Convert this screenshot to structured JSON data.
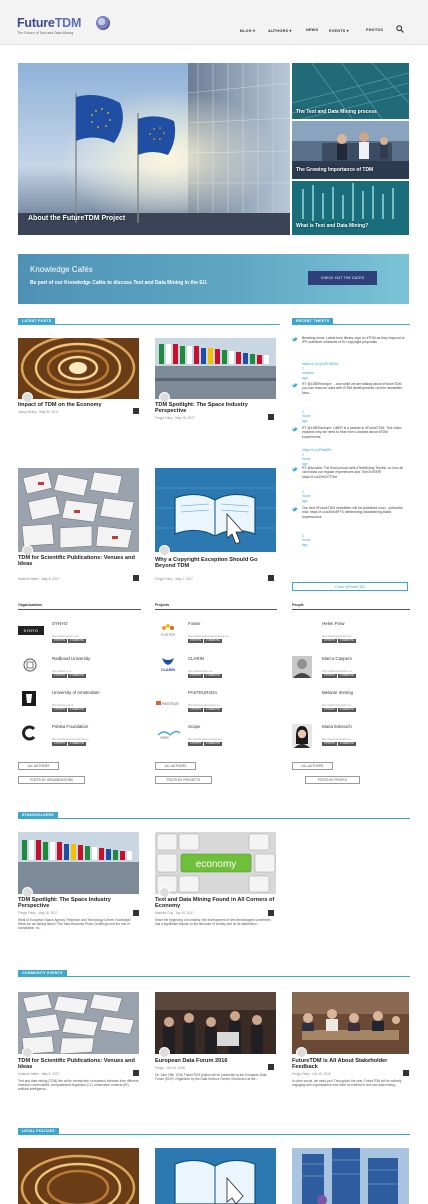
{
  "header": {
    "logo_future": "Future",
    "logo_tdm": "TDM",
    "tagline": "The Future of Text and Data Mining",
    "nav": [
      {
        "label": "BLOG ▾"
      },
      {
        "label": "AUTHORS ▾"
      },
      {
        "label": "NEWS"
      },
      {
        "label": "EVENTS ▾"
      },
      {
        "label": "PHOTOS"
      }
    ]
  },
  "hero": {
    "main_caption": "About the FutureTDM Project",
    "side": [
      {
        "caption": "The Text and Data Mining process"
      },
      {
        "caption": "The Growing Importance of TDM"
      },
      {
        "caption": "What is Text and Data Mining?"
      }
    ]
  },
  "knowledge_cafe": {
    "title": "Knowledge Cafés",
    "subtitle": "Be part of our Knowledge Cafés to discuss Text and Data Mining in the EU.",
    "button": "CHECK OUT THE DATES"
  },
  "latest_posts": {
    "tab": "LATEST POSTS",
    "posts": [
      {
        "title": "Impact of TDM on the Economy",
        "meta": "Jenny Molloy · May 30, 2017"
      },
      {
        "title": "TDM Spotlight: The Space Industry Perspective",
        "meta": "Freyja Foley · May 18, 2017"
      },
      {
        "title": "TDM for Scientific Publications: Venues and Ideas",
        "meta": "Kristina Hettne · May 8, 2017"
      },
      {
        "title": "Why a Copyright Exception Should Go Beyond TDM",
        "meta": "Freyja Foley · May 2, 2017"
      }
    ]
  },
  "recent_tweets": {
    "tab": "RECENT TWEETS",
    "tweets": [
      {
        "text": "Breaking news: Latest from library orgs on #TDM as they respond to IPR publisher criticisms of EU copyright proposals",
        "link": "https://t.co/Q0yRHx82W",
        "time": "7 minutes ago"
      },
      {
        "text": "RT @LIBEReurope: ...and while we are talking about #FutureTDM you can read our data with #TDM developments via this newsletter. New...",
        "link": "",
        "time": "2 hours ago"
      },
      {
        "text": "RT @LIBEReurope: LIBER is a partner in #FutureTDM. This video explains why we need to hear from Libraries about #TDM experiences.",
        "link": "https://t.co/ZfAwjRb",
        "time": "2 hours ago"
      },
      {
        "text": "RT @suzaba: The final journal calls #TextMining TechNL on how all can follow our regular experiences and TheOf #SERI https://t.co/ZHeZi7FJhe",
        "link": "",
        "time": "2 hours ago"
      },
      {
        "text": "Our next #FutureTDM newsletter will be published soon - subscribe now: https://t.co/z2b6v5FTK #textmining #datamining #data #opensource",
        "link": "",
        "time": "2 hours ago"
      }
    ],
    "follow_button": "Follow @FutureTDM"
  },
  "directory": {
    "organisations": {
      "heading": "Organisations",
      "items": [
        {
          "name": "SYNYO",
          "url": "http://www.synyo.com"
        },
        {
          "name": "Radboud University",
          "url": "http://www.ru.nl"
        },
        {
          "name": "University of Amsterdam",
          "url": "http://www.uva.nl"
        },
        {
          "name": "Polska Foundation",
          "url": "http://www.centrumcyfrowe.pl"
        }
      ],
      "all_button": "ALL AUTHORS",
      "posts_button": "POSTS BY ORGANISATIONS"
    },
    "projects": {
      "heading": "Projects",
      "items": [
        {
          "name": "Foster",
          "url": "http://www.fosteropenscience.eu"
        },
        {
          "name": "CLARIN",
          "url": "http://www.clarin.eu"
        },
        {
          "name": "PASTEUR4OA",
          "url": "http://www.pasteur4oa.eu"
        },
        {
          "name": "Scape",
          "url": "http://www.scape-project.eu"
        }
      ],
      "all_button": "ALL AUTHORS",
      "posts_button": "POSTS BY PROJECTS"
    },
    "people": {
      "heading": "People",
      "items": [
        {
          "name": "Helen Frew",
          "url": "http://www.futuretdm.eu"
        },
        {
          "name": "Marco Caspers",
          "url": "http://www.futuretdm.eu"
        },
        {
          "name": "Melanie Imming",
          "url": "http://www.futuretdm.eu"
        },
        {
          "name": "Maria Eskevich",
          "url": "http://www.futuretdm.eu"
        }
      ],
      "all_button": "ALL AUTHORS",
      "posts_button": "POSTS BY PEOPLE"
    },
    "chip_posts": "# POSTS",
    "chip_website": "# WEBSITE"
  },
  "stakeholders": {
    "tab": "STAKEHOLDERS",
    "posts": [
      {
        "title": "TDM Spotlight: The Space Industry Perspective",
        "meta": "Freyja Foley · May 18, 2017",
        "excerpt": "What of European Space Agency, Research and Technology Centre, Noordwijk? What are we talking about? The Intra Business Photo Challenge and the role of compilation, m..."
      },
      {
        "title": "Text and Data Mining Found in All Corners of Economy",
        "meta": "Marieke Guy · Apr 10, 2017",
        "excerpt": "Since the beginning of humanity, the development of new technologies sometimes had a significant impact on the structure of society and on its distribution..."
      }
    ]
  },
  "community": {
    "tab": "COMMUNITY EVENTS",
    "posts": [
      {
        "title": "TDM for Scientific Publications: Venues and Ideas",
        "meta": "Kristina Hettne · May 8, 2017",
        "excerpt": "Text and data mining (TDM) lies at the intersection of research interests from different research communities: computational linguistics (CL), information retrieval (IR), artificial intelligence..."
      },
      {
        "title": "European Data Forum 2016",
        "meta": "Freyja · Oct 19, 2016",
        "excerpt": "On June 29th, 2016 FutureTDM project will be presented at the European Data Forum (EDF). Organised by the Data Science Center, Eindhoven at the..."
      },
      {
        "title": "FutureTDM is All About Stakeholder Feedback",
        "meta": "Freyja Foley · Oct 19, 2016",
        "excerpt": "In other words, we need you! Throughout the year, FutureTDM will be actively engaging with organisations who have an interest in text and data mining..."
      }
    ]
  },
  "legal": {
    "tab": "LEGAL POLICIES"
  },
  "colors": {
    "accent": "#3fa6cd",
    "brand": "#3b4a8c",
    "button_dark": "#2e3f7a"
  }
}
